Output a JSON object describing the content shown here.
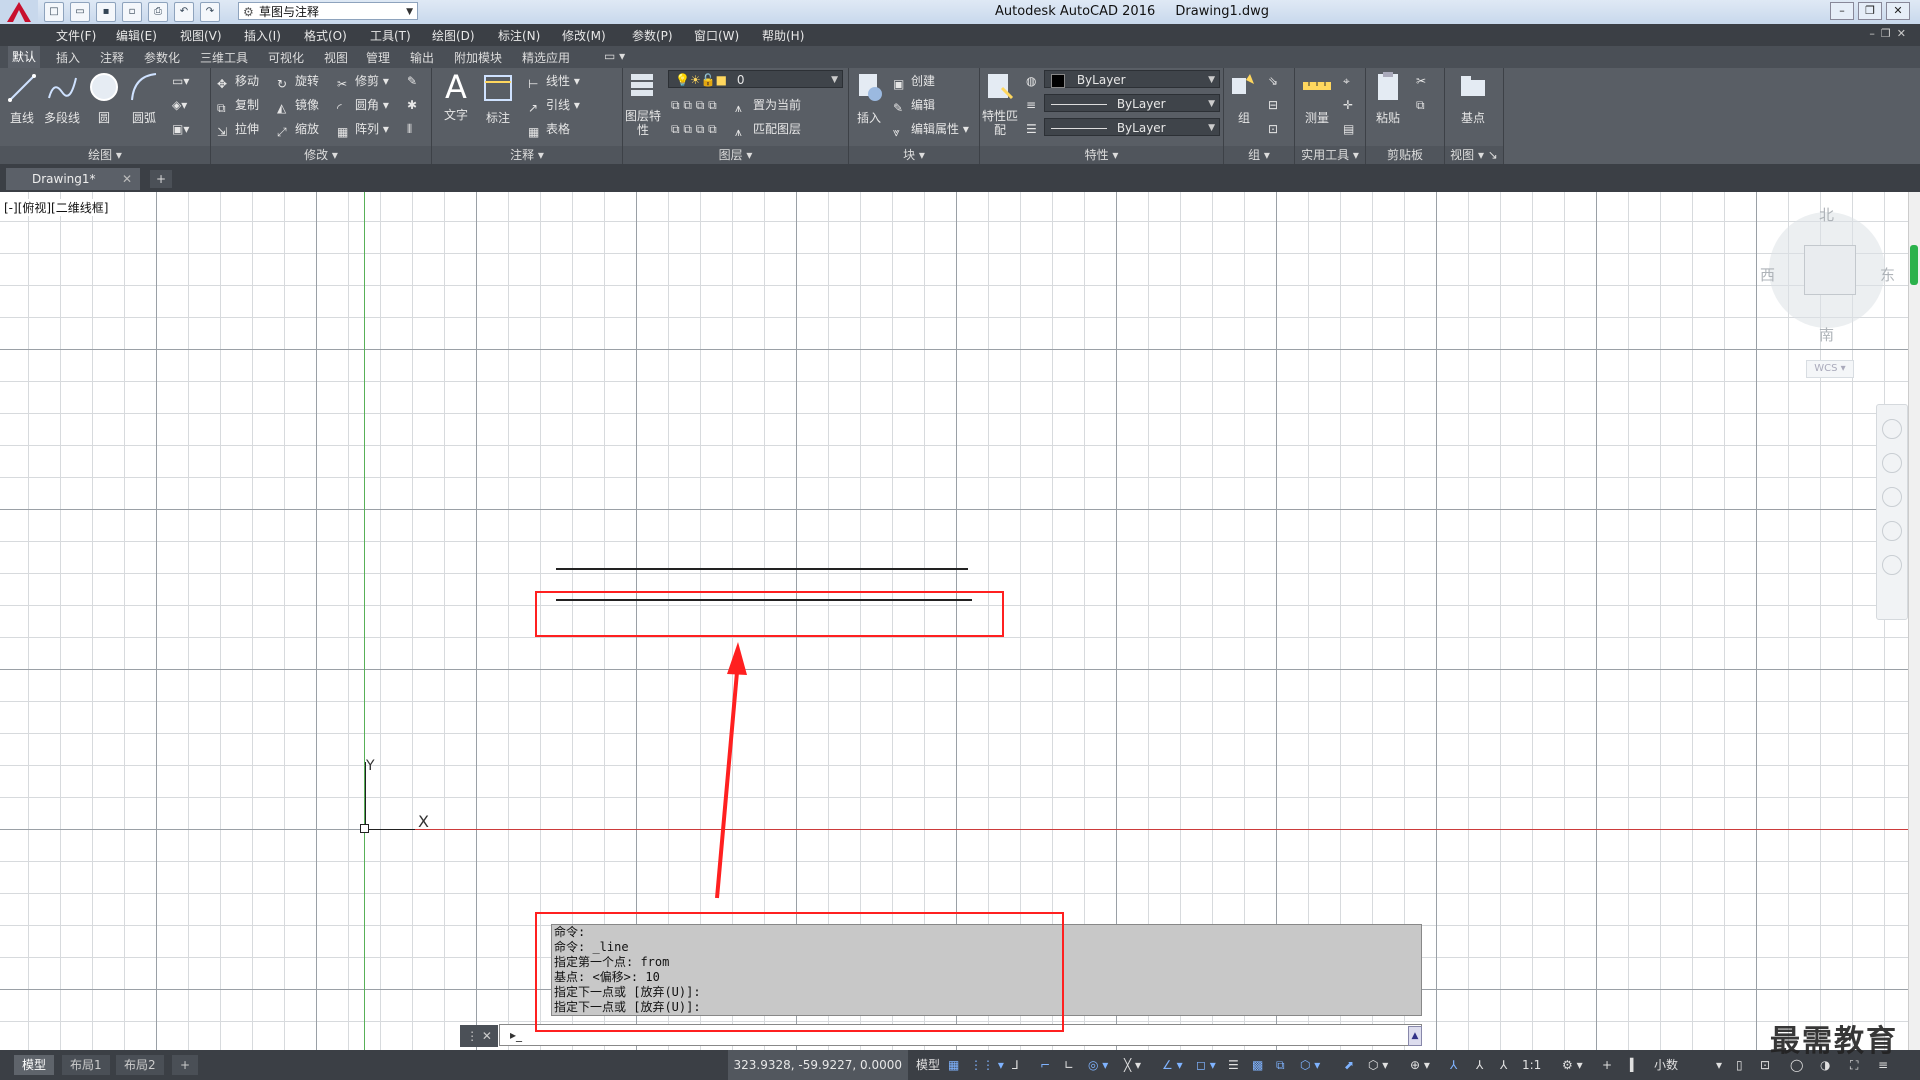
{
  "window": {
    "app_title": "Autodesk AutoCAD 2016",
    "file_name": "Drawing1.dwg",
    "workspace": "草图与注释"
  },
  "menus": [
    "文件(F)",
    "编辑(E)",
    "视图(V)",
    "插入(I)",
    "格式(O)",
    "工具(T)",
    "绘图(D)",
    "标注(N)",
    "修改(M)",
    "参数(P)",
    "窗口(W)",
    "帮助(H)"
  ],
  "ribbon_tabs": [
    "默认",
    "插入",
    "注释",
    "参数化",
    "三维工具",
    "可视化",
    "视图",
    "管理",
    "输出",
    "附加模块",
    "精选应用"
  ],
  "ribbon": {
    "draw": {
      "title": "绘图",
      "line": "直线",
      "polyline": "多段线",
      "circle": "圆",
      "arc": "圆弧"
    },
    "modify": {
      "title": "修改",
      "move": "移动",
      "rotate": "旋转",
      "trim": "修剪",
      "copy": "复制",
      "mirror": "镜像",
      "fillet": "圆角",
      "stretch": "拉伸",
      "scale": "缩放",
      "array": "阵列"
    },
    "annotation": {
      "title": "注释",
      "text": "文字",
      "dimension": "标注",
      "linear": "线性",
      "leader": "引线",
      "table": "表格"
    },
    "layers": {
      "title": "图层",
      "properties": "图层特性",
      "current_layer": "0",
      "set_current": "置为当前",
      "match": "匹配图层"
    },
    "block": {
      "title": "块",
      "insert": "插入",
      "create": "创建",
      "edit": "编辑",
      "edit_attr": "编辑属性"
    },
    "properties": {
      "title": "特性",
      "match": "特性匹配",
      "color": "ByLayer",
      "linetype": "ByLayer",
      "lineweight": "ByLayer"
    },
    "groups": {
      "title": "组",
      "group": "组"
    },
    "utilities": {
      "title": "实用工具",
      "measure": "测量"
    },
    "clipboard": {
      "title": "剪贴板",
      "paste": "粘贴"
    },
    "view": {
      "title": "视图",
      "base": "基点"
    }
  },
  "doc_tab": {
    "name": "Drawing1*"
  },
  "viewport": {
    "label": "[-][俯视][二维线框]",
    "viewcube": {
      "north": "北",
      "south": "南",
      "east": "东",
      "west": "西",
      "ucs": "WCS"
    },
    "ucs_x": "X",
    "ucs_y": "Y"
  },
  "command": {
    "history": [
      "命令:",
      "命令: _line",
      "指定第一个点: from",
      "基点: <偏移>: 10",
      "指定下一点或 [放弃(U)]:",
      "指定下一点或 [放弃(U)]:"
    ],
    "placeholder": ""
  },
  "status": {
    "layout_tabs": [
      "模型",
      "布局1",
      "布局2"
    ],
    "coords": "323.9328, -59.9227, 0.0000",
    "model": "模型",
    "scale": "1:1",
    "units": "小数"
  },
  "watermark": "最需教育",
  "colors": {
    "axis_x": "#cc3b3b",
    "axis_y": "#58b058",
    "highlight": "#ff2020"
  }
}
